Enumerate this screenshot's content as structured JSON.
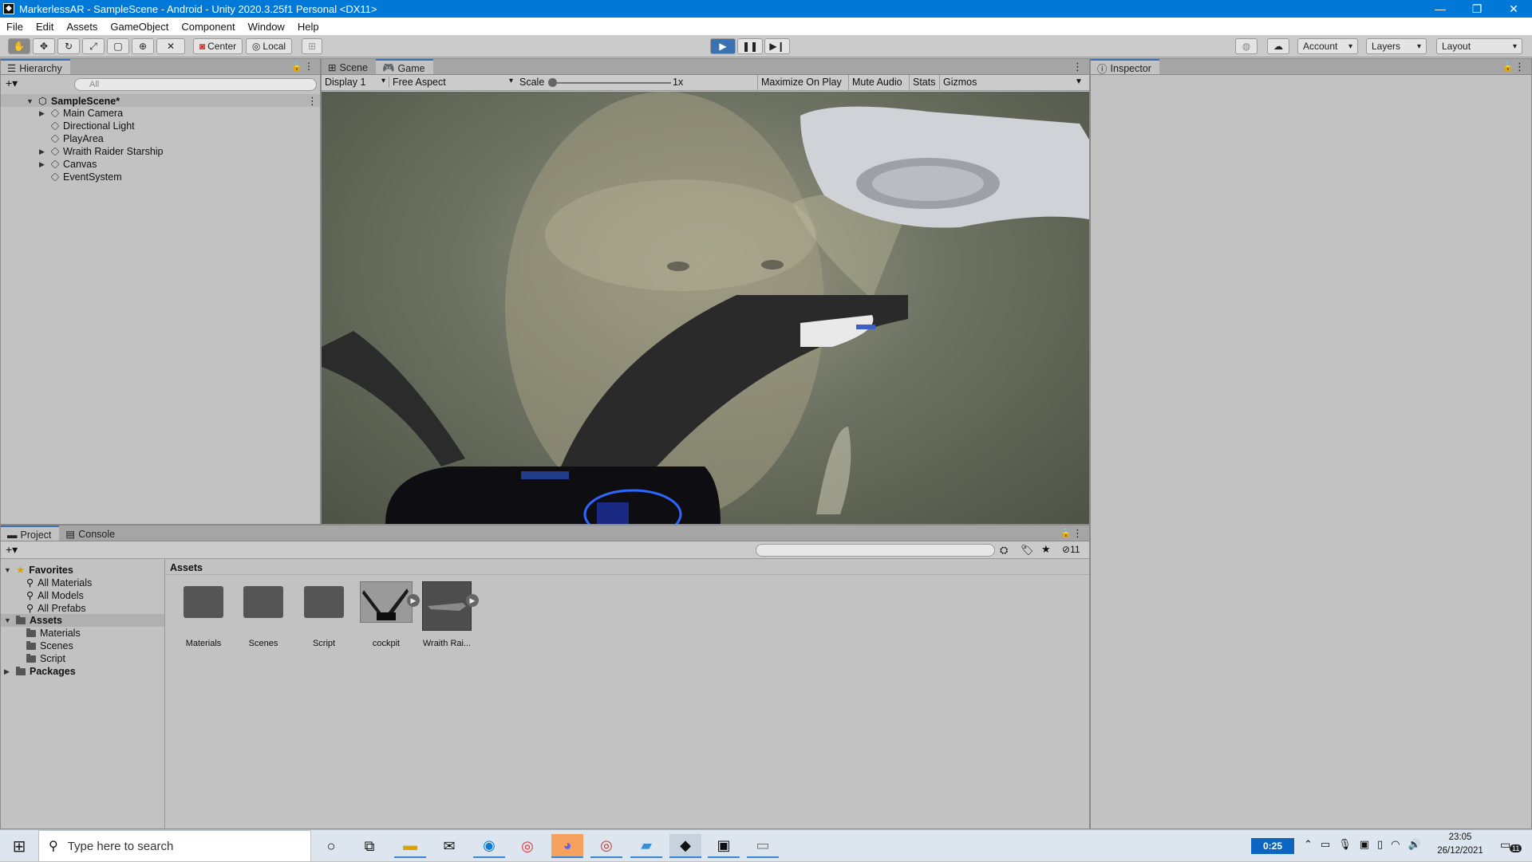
{
  "window": {
    "title": "MarkerlessAR - SampleScene - Android - Unity 2020.3.25f1 Personal <DX11>",
    "icon": "unity-icon",
    "controls": [
      "—",
      "❐",
      "✕"
    ]
  },
  "menu": [
    "File",
    "Edit",
    "Assets",
    "GameObject",
    "Component",
    "Window",
    "Help"
  ],
  "toolbar": {
    "tools": [
      "hand-tool",
      "move-tool",
      "rotate-tool",
      "scale-tool",
      "rect-tool",
      "transform-tool",
      "custom-tool"
    ],
    "pivot_label": "Center",
    "space_label": "Local",
    "account_label": "Account",
    "layers_label": "Layers",
    "layout_label": "Layout"
  },
  "hierarchy": {
    "tab_label": "Hierarchy",
    "search_placeholder": "All",
    "scene_name": "SampleScene*",
    "items": [
      {
        "label": "Main Camera",
        "expandable": true
      },
      {
        "label": "Directional Light",
        "expandable": false
      },
      {
        "label": "PlayArea",
        "expandable": false
      },
      {
        "label": "Wraith Raider Starship",
        "expandable": true
      },
      {
        "label": "Canvas",
        "expandable": true
      },
      {
        "label": "EventSystem",
        "expandable": false
      }
    ]
  },
  "game_view": {
    "tabs": [
      "Scene",
      "Game"
    ],
    "active_tab": "Game",
    "display": "Display 1",
    "aspect": "Free Aspect",
    "scale_label": "Scale",
    "scale_value": "1x",
    "buttons": [
      "Maximize On Play",
      "Mute Audio",
      "Stats",
      "Gizmos"
    ]
  },
  "inspector": {
    "tab_label": "Inspector"
  },
  "project": {
    "tabs": [
      "Project",
      "Console"
    ],
    "hidden_count": "11",
    "favorites_label": "Favorites",
    "favorites": [
      "All Materials",
      "All Models",
      "All Prefabs"
    ],
    "assets_label": "Assets",
    "asset_folders": [
      "Materials",
      "Scenes",
      "Script"
    ],
    "packages_label": "Packages",
    "breadcrumb": "Assets",
    "grid": [
      {
        "label": "Materials",
        "kind": "folder"
      },
      {
        "label": "Scenes",
        "kind": "folder"
      },
      {
        "label": "Script",
        "kind": "folder"
      },
      {
        "label": "cockpit",
        "kind": "model"
      },
      {
        "label": "Wraith Rai...",
        "kind": "model"
      }
    ]
  },
  "taskbar": {
    "search_placeholder": "Type here to search",
    "timer": "0:25",
    "time": "23:05",
    "date": "26/12/2021",
    "notifications": "11",
    "apps": [
      "cortana-icon",
      "task-view-icon",
      "file-explorer-icon",
      "mail-icon",
      "edge-icon",
      "chrome-icon",
      "discord-icon",
      "chrome-profile-icon",
      "notepad-icon",
      "unity-icon",
      "photos-icon",
      "vmware-icon"
    ]
  },
  "colors": {
    "titlebar": "#0078d7",
    "editor_bg": "#c2c2c2",
    "accent": "#3a72b0"
  }
}
